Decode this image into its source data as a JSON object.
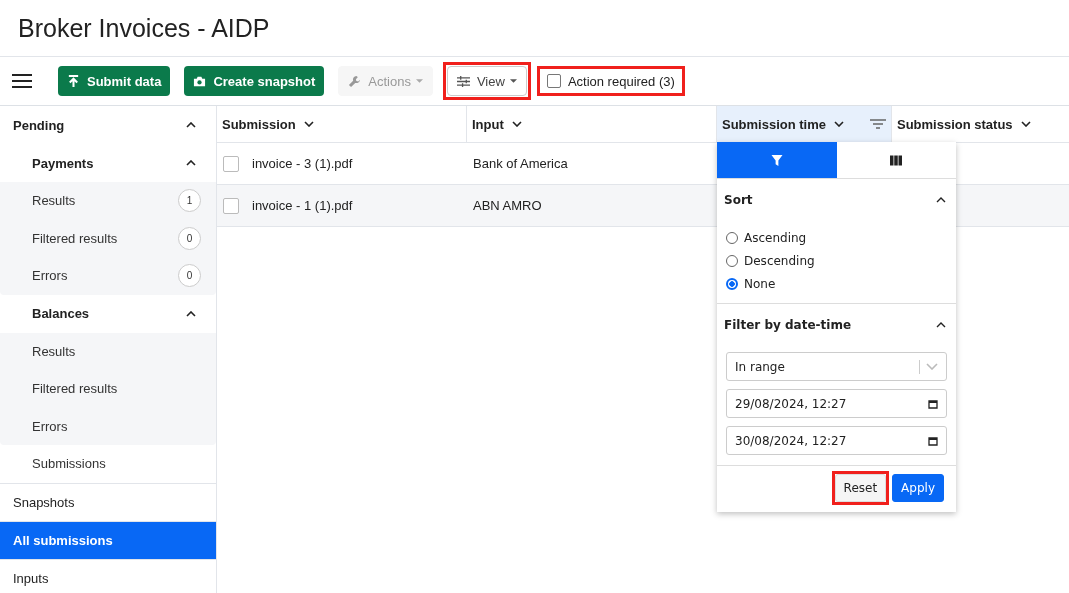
{
  "title": "Broker Invoices - AIDP",
  "toolbar": [
    {
      "kind": "primary",
      "label": "Submit data",
      "highlighted": false
    },
    {
      "kind": "primary",
      "label": "Create snapshot",
      "highlighted": false
    },
    {
      "kind": "menu",
      "label": "Actions",
      "disabled": true,
      "highlighted": false
    },
    {
      "kind": "menu",
      "label": "View",
      "disabled": false,
      "highlighted": true
    },
    {
      "kind": "checkbox",
      "label": "Action required (3)",
      "checked": false,
      "highlighted": true
    }
  ],
  "sidebar": [
    {
      "label": "Pending",
      "expanded": true,
      "children": [
        {
          "label": "Payments",
          "expanded": true,
          "children": [
            {
              "label": "Results",
              "count": "1"
            },
            {
              "label": "Filtered results",
              "count": "0"
            },
            {
              "label": "Errors",
              "count": "0"
            }
          ]
        },
        {
          "label": "Balances",
          "expanded": true,
          "children": [
            {
              "label": "Results"
            },
            {
              "label": "Filtered results"
            },
            {
              "label": "Errors"
            }
          ]
        },
        {
          "label": "Submissions"
        }
      ]
    },
    {
      "label": "Snapshots",
      "selected": false
    },
    {
      "label": "All submissions",
      "selected": true
    },
    {
      "label": "Inputs",
      "selected": false
    }
  ],
  "table": {
    "columns": [
      {
        "label": "Submission",
        "active": false
      },
      {
        "label": "Input",
        "active": false
      },
      {
        "label": "Submission time",
        "active": true
      },
      {
        "label": "Submission status",
        "active": false
      }
    ],
    "rows": [
      {
        "checked": false,
        "cells": [
          "invoice - 3 (1).pdf",
          "Bank of America"
        ]
      },
      {
        "checked": false,
        "cells": [
          "invoice - 1 (1).pdf",
          "ABN AMRO"
        ]
      }
    ]
  },
  "column_menu": {
    "tabs": [
      {
        "selected": true
      },
      {
        "selected": false
      }
    ],
    "sort_title": "Sort",
    "sort_expanded": true,
    "sort_options": [
      {
        "label": "Ascending",
        "selected": false
      },
      {
        "label": "Descending",
        "selected": false
      },
      {
        "label": "None",
        "selected": true
      }
    ],
    "filter_title": "Filter by date-time",
    "filter_expanded": true,
    "operator": "In range",
    "from": "29/08/2024, 12:27",
    "to": "30/08/2024, 12:27",
    "buttons": [
      {
        "kind": "secondary",
        "label": "Reset",
        "highlighted": true
      },
      {
        "kind": "primary",
        "label": "Apply",
        "highlighted": false
      }
    ]
  }
}
